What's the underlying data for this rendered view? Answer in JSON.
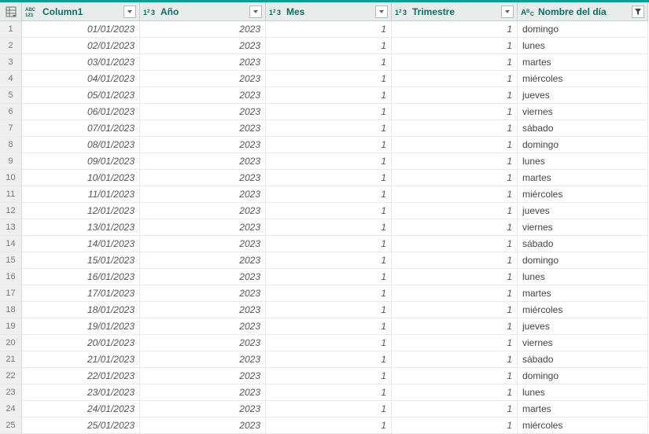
{
  "columns": [
    {
      "name": "Column1",
      "type": "any"
    },
    {
      "name": "Año",
      "type": "int"
    },
    {
      "name": "Mes",
      "type": "int"
    },
    {
      "name": "Trimestre",
      "type": "int"
    },
    {
      "name": "Nombre del día",
      "type": "text",
      "filtered": true
    }
  ],
  "rows": [
    {
      "n": "1",
      "c1": "01/01/2023",
      "c2": "2023",
      "c3": "1",
      "c4": "1",
      "c5": "domingo"
    },
    {
      "n": "2",
      "c1": "02/01/2023",
      "c2": "2023",
      "c3": "1",
      "c4": "1",
      "c5": "lunes"
    },
    {
      "n": "3",
      "c1": "03/01/2023",
      "c2": "2023",
      "c3": "1",
      "c4": "1",
      "c5": "martes"
    },
    {
      "n": "4",
      "c1": "04/01/2023",
      "c2": "2023",
      "c3": "1",
      "c4": "1",
      "c5": "miércoles"
    },
    {
      "n": "5",
      "c1": "05/01/2023",
      "c2": "2023",
      "c3": "1",
      "c4": "1",
      "c5": "jueves"
    },
    {
      "n": "6",
      "c1": "06/01/2023",
      "c2": "2023",
      "c3": "1",
      "c4": "1",
      "c5": "viernes"
    },
    {
      "n": "7",
      "c1": "07/01/2023",
      "c2": "2023",
      "c3": "1",
      "c4": "1",
      "c5": "sábado"
    },
    {
      "n": "8",
      "c1": "08/01/2023",
      "c2": "2023",
      "c3": "1",
      "c4": "1",
      "c5": "domingo"
    },
    {
      "n": "9",
      "c1": "09/01/2023",
      "c2": "2023",
      "c3": "1",
      "c4": "1",
      "c5": "lunes"
    },
    {
      "n": "10",
      "c1": "10/01/2023",
      "c2": "2023",
      "c3": "1",
      "c4": "1",
      "c5": "martes"
    },
    {
      "n": "11",
      "c1": "11/01/2023",
      "c2": "2023",
      "c3": "1",
      "c4": "1",
      "c5": "miércoles"
    },
    {
      "n": "12",
      "c1": "12/01/2023",
      "c2": "2023",
      "c3": "1",
      "c4": "1",
      "c5": "jueves"
    },
    {
      "n": "13",
      "c1": "13/01/2023",
      "c2": "2023",
      "c3": "1",
      "c4": "1",
      "c5": "viernes"
    },
    {
      "n": "14",
      "c1": "14/01/2023",
      "c2": "2023",
      "c3": "1",
      "c4": "1",
      "c5": "sábado"
    },
    {
      "n": "15",
      "c1": "15/01/2023",
      "c2": "2023",
      "c3": "1",
      "c4": "1",
      "c5": "domingo"
    },
    {
      "n": "16",
      "c1": "16/01/2023",
      "c2": "2023",
      "c3": "1",
      "c4": "1",
      "c5": "lunes"
    },
    {
      "n": "17",
      "c1": "17/01/2023",
      "c2": "2023",
      "c3": "1",
      "c4": "1",
      "c5": "martes"
    },
    {
      "n": "18",
      "c1": "18/01/2023",
      "c2": "2023",
      "c3": "1",
      "c4": "1",
      "c5": "miércoles"
    },
    {
      "n": "19",
      "c1": "19/01/2023",
      "c2": "2023",
      "c3": "1",
      "c4": "1",
      "c5": "jueves"
    },
    {
      "n": "20",
      "c1": "20/01/2023",
      "c2": "2023",
      "c3": "1",
      "c4": "1",
      "c5": "viernes"
    },
    {
      "n": "21",
      "c1": "21/01/2023",
      "c2": "2023",
      "c3": "1",
      "c4": "1",
      "c5": "sábado"
    },
    {
      "n": "22",
      "c1": "22/01/2023",
      "c2": "2023",
      "c3": "1",
      "c4": "1",
      "c5": "domingo"
    },
    {
      "n": "23",
      "c1": "23/01/2023",
      "c2": "2023",
      "c3": "1",
      "c4": "1",
      "c5": "lunes"
    },
    {
      "n": "24",
      "c1": "24/01/2023",
      "c2": "2023",
      "c3": "1",
      "c4": "1",
      "c5": "martes"
    },
    {
      "n": "25",
      "c1": "25/01/2023",
      "c2": "2023",
      "c3": "1",
      "c4": "1",
      "c5": "miércoles"
    }
  ]
}
